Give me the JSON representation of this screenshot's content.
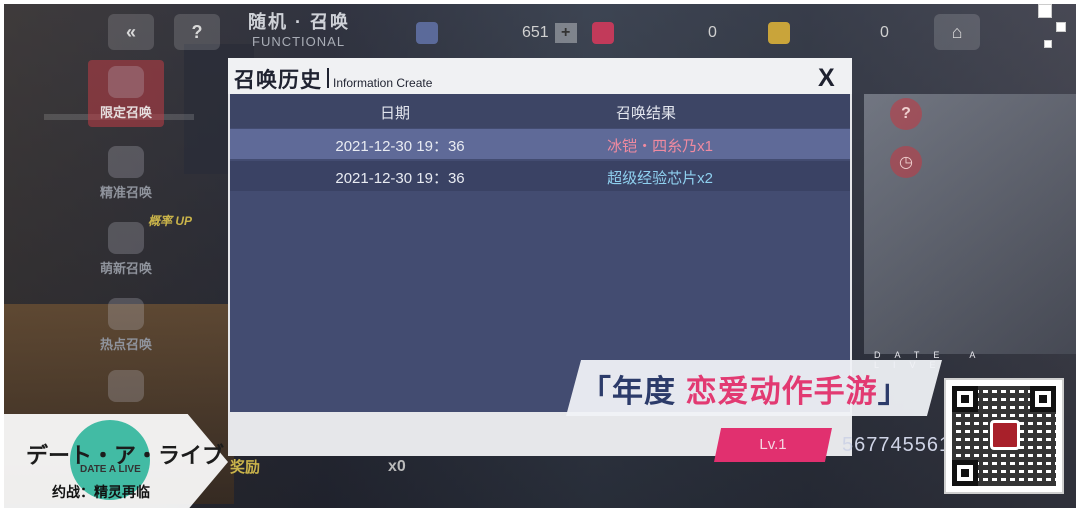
{
  "topbar": {
    "back_icon": "chevron-left-icon",
    "help_label": "?",
    "title": "随机 · 召唤",
    "subtitle": "FUNCTIONAL",
    "resources": [
      {
        "icon": "crystal-icon",
        "value": "651",
        "plus": "+",
        "color": "#5b6a9a"
      },
      {
        "icon": "heart-gem-icon",
        "value": "0",
        "color": "#c23a5a"
      },
      {
        "icon": "gold-gem-icon",
        "value": "0",
        "color": "#c9a43a"
      }
    ]
  },
  "left_menu": {
    "items": [
      {
        "label": "限定召唤",
        "icon": "limited-summon-icon",
        "active": true
      },
      {
        "label": "精准召唤",
        "icon": "precise-summon-icon"
      },
      {
        "label": "萌新召唤",
        "icon": "newbie-summon-icon"
      },
      {
        "label": "热点召唤",
        "icon": "hot-summon-icon"
      },
      {
        "label": "",
        "icon": "heart-icon"
      }
    ],
    "rate_up_tag": "概率 UP"
  },
  "right_icons": [
    {
      "icon": "help-icon",
      "label": "?"
    },
    {
      "icon": "timer-icon",
      "label": "◷"
    }
  ],
  "bottom_bar": {
    "left_text": "奖励",
    "count": "x0"
  },
  "modal": {
    "title": "召唤历史",
    "subtitle": "Information Create",
    "close_label": "X",
    "columns": [
      "日期",
      "召唤结果"
    ],
    "rows": [
      {
        "date": "2021-12-30 19：36",
        "result": "冰铠・四糸乃x1",
        "result_color": "#f08aa0"
      },
      {
        "date": "2021-12-30 19：36",
        "result": "超级经验芯片x2",
        "result_color": "#8fd0ef"
      }
    ]
  },
  "logo": {
    "jp": "デート・ア・ライブ",
    "en": "DATE A LIVE",
    "cn": "约战：精灵再临"
  },
  "promo": {
    "open_bracket": "「",
    "part1": "年度",
    "part2": "恋爱动作手游",
    "close_bracket": "」",
    "date_a_live": "DATE A LIVE",
    "level": "Lv.1",
    "uid": "567745561"
  }
}
